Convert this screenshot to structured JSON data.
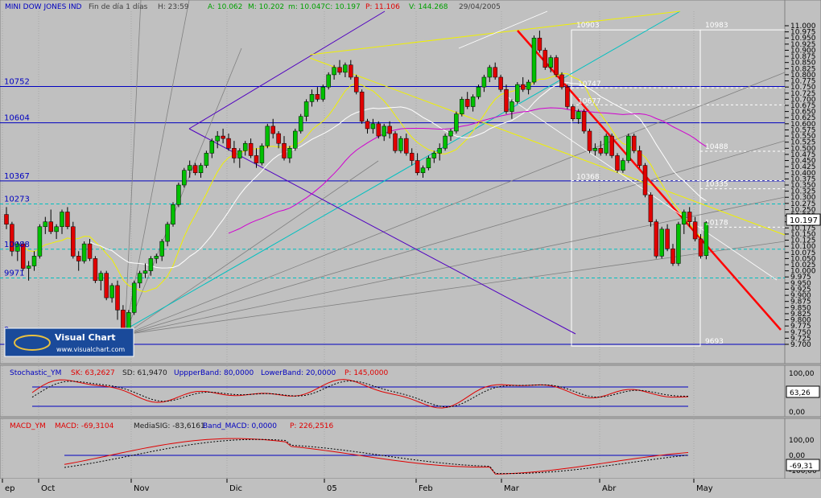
{
  "header": {
    "instrument": "MINI DOW JONES IND",
    "period": "Fin de día 1 días",
    "hour": "H: 23:59",
    "open": "A: 10.062",
    "high": "M: 10.202",
    "low": "m: 10.047",
    "close": "C: 10.197",
    "p": "P: 11.106",
    "v": "V: 144.268",
    "date": "29/04/2005"
  },
  "logo": {
    "name": "Visual Chart",
    "url": "www.visualchart.com"
  },
  "price_axis": {
    "ticks": [
      "11.000",
      "10.975",
      "10.950",
      "10.925",
      "10.900",
      "10.875",
      "10.850",
      "10.825",
      "10.800",
      "10.775",
      "10.750",
      "10.725",
      "10.700",
      "10.675",
      "10.650",
      "10.625",
      "10.600",
      "10.575",
      "10.550",
      "10.525",
      "10.500",
      "10.475",
      "10.450",
      "10.425",
      "10.400",
      "10.375",
      "10.350",
      "10.325",
      "10.300",
      "10.275",
      "10.250",
      "10.225",
      "10.200",
      "10.175",
      "10.150",
      "10.125",
      "10.100",
      "10.075",
      "10.050",
      "10.025",
      "10.000",
      "9.975",
      "9.950",
      "9.925",
      "9.900",
      "9.875",
      "9.850",
      "9.825",
      "9.800",
      "9.775",
      "9.750",
      "9.725",
      "9.700"
    ],
    "current_price": "10.197"
  },
  "level_labels": {
    "left": [
      "10752",
      "10604",
      "10367",
      "10273",
      "10088",
      "9971",
      "9"
    ],
    "right": [
      "10983",
      "10488",
      "10335",
      "10178",
      "9693"
    ],
    "mid": [
      "10903",
      "10747",
      "10677",
      "10368"
    ]
  },
  "x_axis": {
    "labels": [
      "ep",
      "Oct",
      "Nov",
      "Dic",
      "05",
      "Feb",
      "Mar",
      "Abr",
      "May"
    ]
  },
  "stochastic": {
    "title": "Stochastic_YM",
    "sk": "SK: 63,2627",
    "sd": "SD: 61,9470",
    "upper": "UppperBand: 80,0000",
    "lower": "LowerBand: 20,0000",
    "p": "P: 145,0000",
    "axis": [
      "100,00",
      "0,00"
    ],
    "current": "63,26"
  },
  "macd": {
    "title": "MACD_YM",
    "macd": "MACD: -69,3104",
    "signal": "MediaSIG: -83,6161",
    "band": "Band_MACD: 0,0000",
    "p": "P: 226,2516",
    "axis": [
      "100,00",
      "0,00",
      "-100,00"
    ],
    "current": "-69,31"
  },
  "colors": {
    "background": "#c0c0c0",
    "up_candle": "#00c000",
    "down_candle": "#e00000",
    "blue_levels": "#0000c0",
    "cyan_levels": "#00c0c0",
    "yellow_line": "#f0f000",
    "magenta_line": "#d000d0",
    "trend_red": "#ff0000"
  },
  "chart_data": {
    "type": "candlestick",
    "title": "MINI DOW JONES IND",
    "ylim": [
      9700,
      11000
    ],
    "x_categories": [
      "Sep",
      "Oct",
      "Nov",
      "Dic",
      "2005",
      "Feb",
      "Mar",
      "Abr",
      "May"
    ],
    "ohlc_approx": [
      [
        10230,
        10260,
        10170,
        10190
      ],
      [
        10190,
        10200,
        10060,
        10080
      ],
      [
        10080,
        10120,
        10040,
        10110
      ],
      [
        10110,
        10120,
        10000,
        10010
      ],
      [
        10010,
        10040,
        9960,
        10020
      ],
      [
        10020,
        10080,
        10000,
        10060
      ],
      [
        10060,
        10190,
        10050,
        10180
      ],
      [
        10180,
        10220,
        10150,
        10200
      ],
      [
        10200,
        10250,
        10150,
        10160
      ],
      [
        10160,
        10190,
        10130,
        10180
      ],
      [
        10180,
        10250,
        10150,
        10240
      ],
      [
        10240,
        10260,
        10170,
        10180
      ],
      [
        10180,
        10200,
        10050,
        10060
      ],
      [
        10060,
        10080,
        10000,
        10040
      ],
      [
        10040,
        10120,
        10030,
        10110
      ],
      [
        10110,
        10130,
        10040,
        10050
      ],
      [
        10050,
        10060,
        9950,
        9960
      ],
      [
        9960,
        10000,
        9920,
        9990
      ],
      [
        9990,
        10000,
        9880,
        9890
      ],
      [
        9890,
        9950,
        9870,
        9940
      ],
      [
        9940,
        9960,
        9800,
        9840
      ],
      [
        9840,
        9860,
        9740,
        9750
      ],
      [
        9750,
        9840,
        9740,
        9830
      ],
      [
        9830,
        9960,
        9820,
        9950
      ],
      [
        9950,
        10000,
        9930,
        9990
      ],
      [
        9990,
        10030,
        9970,
        10000
      ],
      [
        10000,
        10060,
        9980,
        10050
      ],
      [
        10050,
        10070,
        10030,
        10060
      ],
      [
        10060,
        10130,
        10040,
        10120
      ],
      [
        10120,
        10200,
        10100,
        10190
      ],
      [
        10190,
        10280,
        10180,
        10270
      ],
      [
        10270,
        10360,
        10260,
        10350
      ],
      [
        10350,
        10420,
        10340,
        10410
      ],
      [
        10410,
        10450,
        10380,
        10430
      ],
      [
        10430,
        10440,
        10390,
        10400
      ],
      [
        10400,
        10440,
        10380,
        10430
      ],
      [
        10430,
        10490,
        10420,
        10480
      ],
      [
        10480,
        10540,
        10460,
        10530
      ],
      [
        10530,
        10570,
        10500,
        10550
      ],
      [
        10550,
        10580,
        10520,
        10540
      ],
      [
        10540,
        10560,
        10490,
        10500
      ],
      [
        10500,
        10530,
        10440,
        10460
      ],
      [
        10460,
        10500,
        10420,
        10490
      ],
      [
        10490,
        10530,
        10470,
        10520
      ],
      [
        10520,
        10540,
        10460,
        10470
      ],
      [
        10470,
        10500,
        10420,
        10440
      ],
      [
        10440,
        10520,
        10430,
        10510
      ],
      [
        10510,
        10600,
        10500,
        10590
      ],
      [
        10590,
        10620,
        10540,
        10560
      ],
      [
        10560,
        10570,
        10500,
        10520
      ],
      [
        10520,
        10550,
        10450,
        10460
      ],
      [
        10460,
        10510,
        10440,
        10500
      ],
      [
        10500,
        10580,
        10490,
        10570
      ],
      [
        10570,
        10640,
        10560,
        10630
      ],
      [
        10630,
        10700,
        10610,
        10690
      ],
      [
        10690,
        10740,
        10670,
        10720
      ],
      [
        10720,
        10750,
        10690,
        10700
      ],
      [
        10700,
        10760,
        10690,
        10750
      ],
      [
        10750,
        10810,
        10740,
        10800
      ],
      [
        10800,
        10840,
        10780,
        10830
      ],
      [
        10830,
        10860,
        10800,
        10810
      ],
      [
        10810,
        10850,
        10790,
        10840
      ],
      [
        10840,
        10860,
        10780,
        10790
      ],
      [
        10790,
        10800,
        10720,
        10730
      ],
      [
        10730,
        10740,
        10600,
        10610
      ],
      [
        10610,
        10620,
        10560,
        10580
      ],
      [
        10580,
        10620,
        10560,
        10600
      ],
      [
        10600,
        10610,
        10540,
        10550
      ],
      [
        10550,
        10600,
        10530,
        10590
      ],
      [
        10590,
        10610,
        10540,
        10560
      ],
      [
        10560,
        10570,
        10480,
        10490
      ],
      [
        10490,
        10550,
        10480,
        10540
      ],
      [
        10540,
        10560,
        10470,
        10480
      ],
      [
        10480,
        10500,
        10430,
        10450
      ],
      [
        10450,
        10480,
        10390,
        10400
      ],
      [
        10400,
        10430,
        10380,
        10420
      ],
      [
        10420,
        10470,
        10410,
        10460
      ],
      [
        10460,
        10490,
        10440,
        10480
      ],
      [
        10480,
        10520,
        10450,
        10500
      ],
      [
        10500,
        10560,
        10490,
        10550
      ],
      [
        10550,
        10580,
        10530,
        10570
      ],
      [
        10570,
        10650,
        10560,
        10640
      ],
      [
        10640,
        10710,
        10630,
        10700
      ],
      [
        10700,
        10730,
        10660,
        10670
      ],
      [
        10670,
        10720,
        10650,
        10710
      ],
      [
        10710,
        10760,
        10700,
        10750
      ],
      [
        10750,
        10800,
        10730,
        10790
      ],
      [
        10790,
        10840,
        10770,
        10830
      ],
      [
        10830,
        10850,
        10780,
        10790
      ],
      [
        10790,
        10800,
        10730,
        10740
      ],
      [
        10740,
        10760,
        10640,
        10650
      ],
      [
        10650,
        10700,
        10620,
        10690
      ],
      [
        10690,
        10770,
        10680,
        10760
      ],
      [
        10760,
        10790,
        10730,
        10740
      ],
      [
        10740,
        10780,
        10720,
        10770
      ],
      [
        10770,
        10960,
        10760,
        10950
      ],
      [
        10950,
        10980,
        10890,
        10900
      ],
      [
        10900,
        10910,
        10820,
        10830
      ],
      [
        10830,
        10880,
        10810,
        10870
      ],
      [
        10870,
        10880,
        10790,
        10800
      ],
      [
        10800,
        10810,
        10740,
        10750
      ],
      [
        10750,
        10760,
        10660,
        10670
      ],
      [
        10670,
        10680,
        10610,
        10620
      ],
      [
        10620,
        10660,
        10600,
        10650
      ],
      [
        10650,
        10660,
        10560,
        10570
      ],
      [
        10570,
        10580,
        10480,
        10490
      ],
      [
        10490,
        10520,
        10470,
        10500
      ],
      [
        10500,
        10530,
        10470,
        10480
      ],
      [
        10480,
        10560,
        10470,
        10550
      ],
      [
        10550,
        10560,
        10460,
        10470
      ],
      [
        10470,
        10480,
        10400,
        10410
      ],
      [
        10410,
        10460,
        10400,
        10450
      ],
      [
        10450,
        10560,
        10440,
        10550
      ],
      [
        10550,
        10560,
        10480,
        10490
      ],
      [
        10490,
        10510,
        10420,
        10430
      ],
      [
        10430,
        10440,
        10300,
        10310
      ],
      [
        10310,
        10320,
        10180,
        10200
      ],
      [
        10200,
        10210,
        10050,
        10060
      ],
      [
        10060,
        10180,
        10050,
        10170
      ],
      [
        10170,
        10190,
        10080,
        10090
      ],
      [
        10090,
        10110,
        10020,
        10030
      ],
      [
        10030,
        10200,
        10020,
        10190
      ],
      [
        10190,
        10250,
        10150,
        10240
      ],
      [
        10240,
        10260,
        10180,
        10200
      ],
      [
        10200,
        10220,
        10120,
        10130
      ],
      [
        10130,
        10150,
        10050,
        10060
      ],
      [
        10062,
        10202,
        10047,
        10197
      ]
    ],
    "horizontal_levels_blue": [
      10752,
      10604,
      10367,
      9700
    ],
    "horizontal_levels_cyan": [
      10273,
      10088,
      9971
    ],
    "annotations": [
      "10983",
      "10903",
      "10747",
      "10677",
      "10488",
      "10368",
      "10335",
      "10178",
      "9693"
    ]
  }
}
